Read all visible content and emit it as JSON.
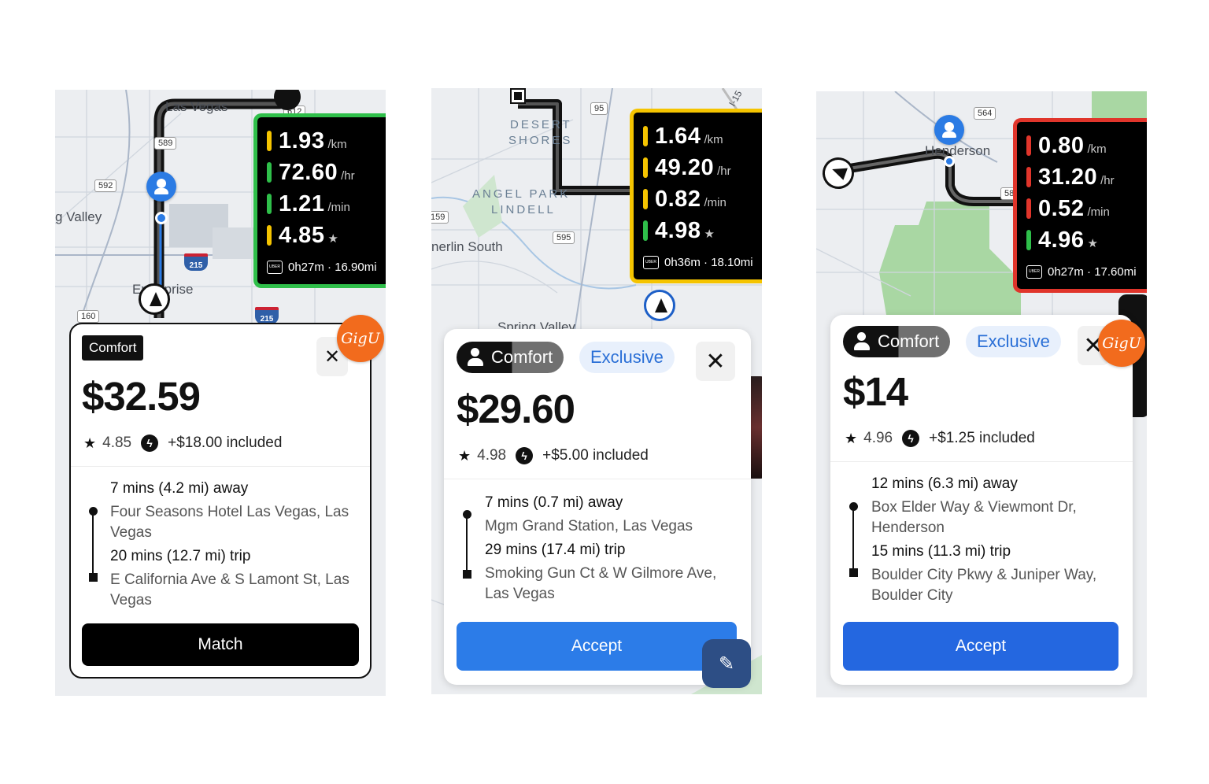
{
  "panels": [
    {
      "map": {
        "labels": [
          "Las Vegas",
          "g Valley",
          "Enterprise"
        ],
        "shields": [
          "589",
          "592",
          "612",
          "160"
        ],
        "interstates": [
          "215",
          "215"
        ]
      },
      "stats": {
        "accent": "#2fbf4a",
        "rows": [
          {
            "value": "1.93",
            "unit": "/km",
            "color": "#f5c400"
          },
          {
            "value": "72.60",
            "unit": "/hr",
            "color": "#2fbf4a"
          },
          {
            "value": "1.21",
            "unit": "/min",
            "color": "#2fbf4a"
          },
          {
            "value": "4.85",
            "unit": "★",
            "color": "#f5c400"
          }
        ],
        "uber_logo": "UBER",
        "summary": "0h27m · 16.90mi"
      },
      "card": {
        "tag": "Comfort",
        "price": "$32.59",
        "rating": "4.85",
        "included": "+$18.00 included",
        "pickup_time": "7 mins (4.2 mi) away",
        "pickup_addr": "Four Seasons Hotel Las Vegas, Las Vegas",
        "trip_time": "20 mins (12.7 mi) trip",
        "dropoff_addr": "E California Ave & S Lamont St, Las Vegas",
        "button": "Match",
        "close": "✕"
      },
      "gigu": "GigU"
    },
    {
      "map": {
        "labels": [
          "DESERT",
          "SHORES",
          "ANGEL PARK",
          "LINDELL",
          "nerlin South",
          "Spring Valley"
        ],
        "shields": [
          "95",
          "595",
          "159"
        ],
        "road": "I-15"
      },
      "stats": {
        "accent": "#f5c400",
        "rows": [
          {
            "value": "1.64",
            "unit": "/km",
            "color": "#f5c400"
          },
          {
            "value": "49.20",
            "unit": "/hr",
            "color": "#f5c400"
          },
          {
            "value": "0.82",
            "unit": "/min",
            "color": "#f5c400"
          },
          {
            "value": "4.98",
            "unit": "★",
            "color": "#2fbf4a"
          }
        ],
        "uber_logo": "UBER",
        "summary": "0h36m · 18.10mi"
      },
      "card": {
        "tag": "Comfort",
        "tag2": "Exclusive",
        "price": "$29.60",
        "rating": "4.98",
        "included": "+$5.00 included",
        "pickup_time": "7 mins (0.7 mi) away",
        "pickup_addr": "Mgm Grand Station, Las Vegas",
        "trip_time": "29 mins (17.4 mi) trip",
        "dropoff_addr": "Smoking Gun Ct & W Gilmore Ave, Las Vegas",
        "button": "Accept",
        "close": "✕"
      },
      "edit": "✎"
    },
    {
      "map": {
        "labels": [
          "Henderson"
        ],
        "shields": [
          "564",
          "58"
        ]
      },
      "stats": {
        "accent": "#e0352b",
        "rows": [
          {
            "value": "0.80",
            "unit": "/km",
            "color": "#e0352b"
          },
          {
            "value": "31.20",
            "unit": "/hr",
            "color": "#e0352b"
          },
          {
            "value": "0.52",
            "unit": "/min",
            "color": "#e0352b"
          },
          {
            "value": "4.96",
            "unit": "★",
            "color": "#2fbf4a"
          }
        ],
        "uber_logo": "UBER",
        "summary": "0h27m · 17.60mi"
      },
      "card": {
        "tag": "Comfort",
        "tag2": "Exclusive",
        "price": "$14",
        "rating": "4.96",
        "included": "+$1.25 included",
        "pickup_time": "12 mins (6.3 mi) away",
        "pickup_addr": "Box Elder Way & Viewmont Dr, Henderson",
        "trip_time": "15 mins (11.3 mi) trip",
        "dropoff_addr": "Boulder City Pkwy & Juniper Way, Boulder City",
        "button": "Accept",
        "close": "✕"
      },
      "gigu": "GigU"
    }
  ]
}
